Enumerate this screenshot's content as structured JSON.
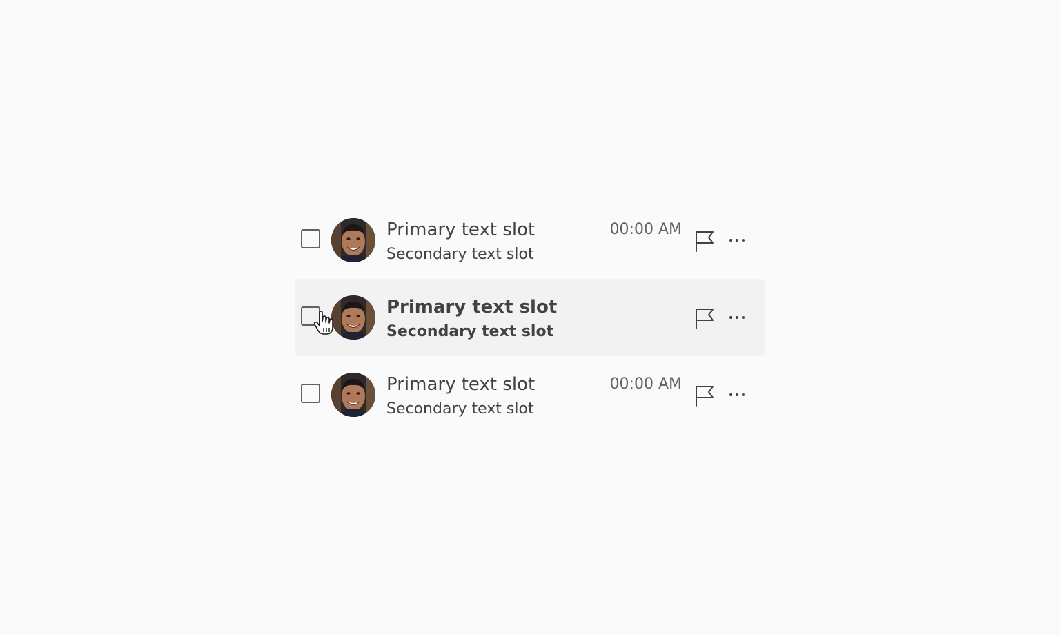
{
  "list": {
    "items": [
      {
        "primary": "Primary text slot",
        "secondary": "Secondary text slot",
        "timestamp": "00:00 AM",
        "hovered": false
      },
      {
        "primary": "Primary text slot",
        "secondary": "Secondary text slot",
        "timestamp": "",
        "hovered": true
      },
      {
        "primary": "Primary text slot",
        "secondary": "Secondary text slot",
        "timestamp": "00:00 AM",
        "hovered": false
      }
    ]
  },
  "icons": {
    "flag": "flag-icon",
    "more": "more-options-icon",
    "cursor": "hand-pointer-cursor-icon"
  },
  "colors": {
    "background": "#fafafa",
    "hover_row": "#f2f2f2",
    "text": "#424242",
    "muted_text": "#616161"
  }
}
